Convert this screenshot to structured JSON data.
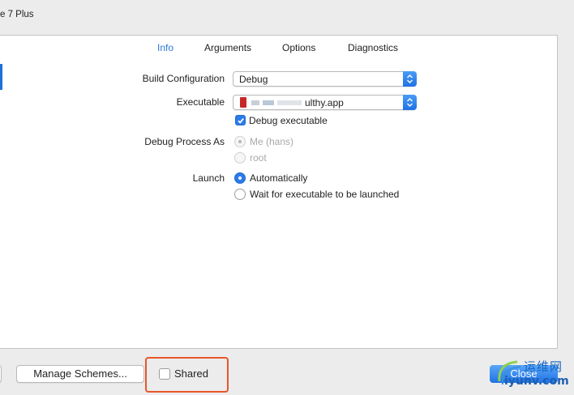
{
  "window": {
    "title_fragment": "e 7 Plus"
  },
  "tabs": [
    {
      "label": "Info",
      "active": true
    },
    {
      "label": "Arguments",
      "active": false
    },
    {
      "label": "Options",
      "active": false
    },
    {
      "label": "Diagnostics",
      "active": false
    }
  ],
  "info": {
    "build_configuration": {
      "label": "Build Configuration",
      "value": "Debug"
    },
    "executable": {
      "label": "Executable",
      "value": "ulthy.app"
    },
    "debug_executable": {
      "label": "Debug executable",
      "checked": true
    },
    "debug_process_as": {
      "label": "Debug Process As",
      "options": [
        {
          "label": "Me (hans)",
          "selected": true,
          "enabled": false
        },
        {
          "label": "root",
          "selected": false,
          "enabled": false
        }
      ]
    },
    "launch": {
      "label": "Launch",
      "options": [
        {
          "label": "Automatically",
          "selected": true
        },
        {
          "label": "Wait for executable to be launched",
          "selected": false
        }
      ]
    }
  },
  "footer": {
    "manage_schemes_label": "Manage Schemes...",
    "shared_label": "Shared",
    "shared_checked": false,
    "close_label": "Close"
  },
  "watermark": {
    "top": "运维网",
    "bottom": "iyunv.com"
  },
  "colors": {
    "accent": "#2a78d6",
    "highlight_border": "#e8562a",
    "selected_control": "#2b7be8"
  }
}
